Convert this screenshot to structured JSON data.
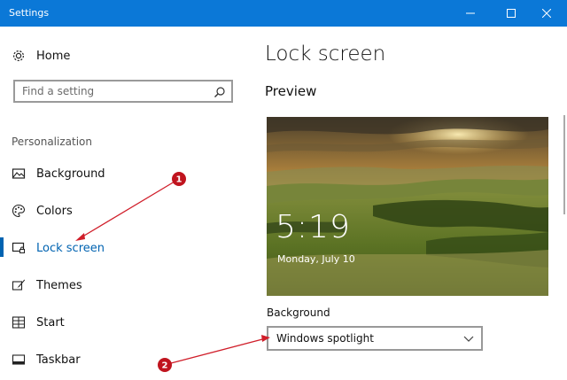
{
  "window": {
    "title": "Settings",
    "accent": "#0b78d7"
  },
  "sidebar": {
    "home_label": "Home",
    "search": {
      "placeholder": "Find a setting"
    },
    "section_title": "Personalization",
    "items": [
      {
        "label": "Background",
        "icon": "image-icon"
      },
      {
        "label": "Colors",
        "icon": "palette-icon"
      },
      {
        "label": "Lock screen",
        "icon": "lock-screen-icon",
        "selected": true
      },
      {
        "label": "Themes",
        "icon": "brush-icon"
      },
      {
        "label": "Start",
        "icon": "start-grid-icon"
      },
      {
        "label": "Taskbar",
        "icon": "taskbar-icon"
      }
    ],
    "selected_color": "#0063b1"
  },
  "main": {
    "title": "Lock screen",
    "preview_heading": "Preview",
    "preview": {
      "time": "5:19",
      "date": "Monday, July 10"
    },
    "background_label": "Background",
    "background_value": "Windows spotlight"
  },
  "annotations": [
    {
      "number": "1",
      "color": "#c0141e"
    },
    {
      "number": "2",
      "color": "#c0141e"
    }
  ]
}
